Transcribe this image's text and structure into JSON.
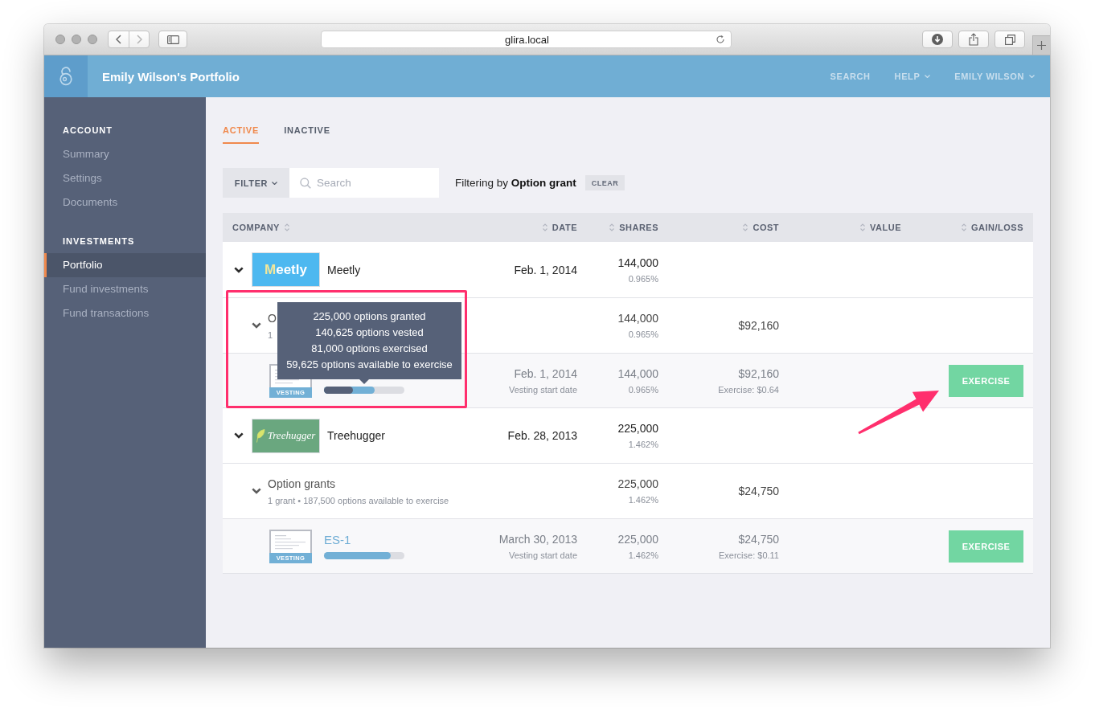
{
  "browser": {
    "url": "glira.local"
  },
  "header": {
    "title": "Emily Wilson's Portfolio",
    "nav": [
      {
        "label": "SEARCH",
        "dropdown": false
      },
      {
        "label": "HELP",
        "dropdown": true
      },
      {
        "label": "EMILY WILSON",
        "dropdown": true
      }
    ]
  },
  "sidebar": {
    "sections": [
      {
        "heading": "ACCOUNT",
        "items": [
          {
            "label": "Summary",
            "selected": false
          },
          {
            "label": "Settings",
            "selected": false
          },
          {
            "label": "Documents",
            "selected": false
          }
        ]
      },
      {
        "heading": "INVESTMENTS",
        "items": [
          {
            "label": "Portfolio",
            "selected": true
          },
          {
            "label": "Fund investments",
            "selected": false
          },
          {
            "label": "Fund transactions",
            "selected": false
          }
        ]
      }
    ]
  },
  "tabs": [
    {
      "label": "ACTIVE",
      "selected": true
    },
    {
      "label": "INACTIVE",
      "selected": false
    }
  ],
  "filter": {
    "button": "FILTER",
    "search": {
      "placeholder": "Search"
    },
    "status": "Filtering by **Option grant**",
    "clear": "CLEAR"
  },
  "table": {
    "columns": [
      {
        "label": "COMPANY"
      },
      {
        "label": "DATE"
      },
      {
        "label": "SHARES"
      },
      {
        "label": "COST"
      },
      {
        "label": "VALUE"
      },
      {
        "label": "GAIN/LOSS"
      }
    ],
    "rows": [
      {
        "kind": "company",
        "expanded": true,
        "logo": {
          "kind": "wordmark",
          "text": "Meetly",
          "color": "#4db8f0"
        },
        "name": "Meetly",
        "date": "Feb. 1, 2014",
        "shares": "144,000",
        "percent": "0.965%"
      },
      {
        "kind": "group",
        "expanded": true,
        "title": "O",
        "subtitle": "1",
        "shares": "144,000",
        "percent": "0.965%",
        "cost": "$92,160"
      },
      {
        "kind": "grant",
        "thumbnail_label": "VESTING",
        "progress": [
          {
            "kind": "vested",
            "level": 0.625
          },
          {
            "kind": "exercised",
            "level": 0.36
          }
        ],
        "tooltip": [
          "225,000 options granted",
          "140,625 options vested",
          "81,000 options exercised",
          "59,625 options available to exercise"
        ],
        "date": "Feb. 1, 2014",
        "date_note": "Vesting start date",
        "shares": "144,000",
        "percent": "0.965%",
        "cost": "$92,160",
        "cost_note": "Exercise: $0.64",
        "action": "EXERCISE"
      },
      {
        "kind": "company",
        "expanded": true,
        "logo": {
          "kind": "leaf",
          "text": "Treehugger",
          "color": "#6aa77f"
        },
        "name": "Treehugger",
        "date": "Feb. 28, 2013",
        "shares": "225,000",
        "percent": "1.462%"
      },
      {
        "kind": "group",
        "expanded": true,
        "title": "Option grants",
        "subtitle": "1 grant • 187,500 options available to exercise",
        "shares": "225,000",
        "percent": "1.462%",
        "cost": "$24,750"
      },
      {
        "kind": "grant",
        "thumbnail_label": "VESTING",
        "name": "ES-1",
        "progress": [
          {
            "kind": "vested",
            "level": 0.83
          }
        ],
        "date": "March 30, 2013",
        "date_note": "Vesting start date",
        "shares": "225,000",
        "percent": "1.462%",
        "cost": "$24,750",
        "cost_note": "Exercise: $0.11",
        "action": "EXERCISE"
      }
    ]
  }
}
